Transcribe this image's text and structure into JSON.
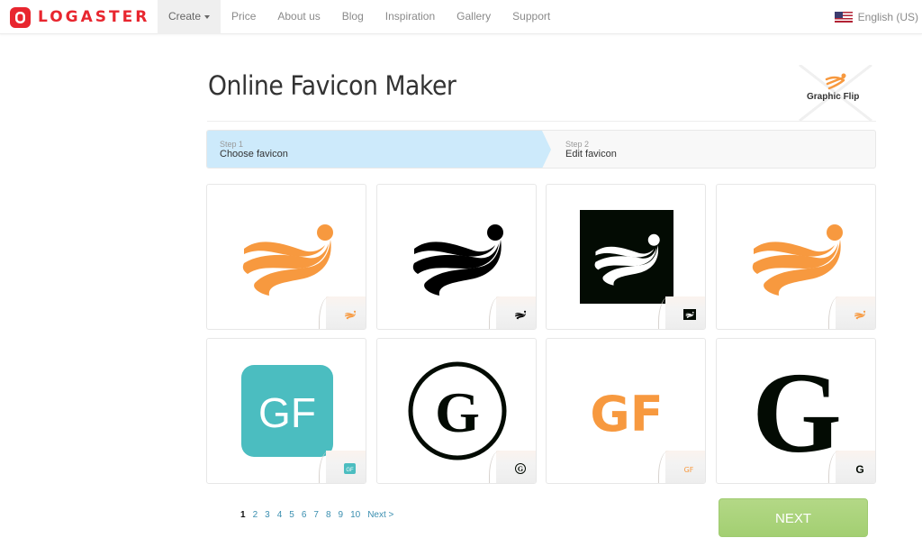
{
  "brand": {
    "name": "LOGASTER",
    "color": "#e8262f"
  },
  "nav": {
    "items": [
      {
        "label": "Create",
        "active": true,
        "dropdown": true
      },
      {
        "label": "Price"
      },
      {
        "label": "About us"
      },
      {
        "label": "Blog"
      },
      {
        "label": "Inspiration"
      },
      {
        "label": "Gallery"
      },
      {
        "label": "Support"
      }
    ],
    "language": {
      "label": "English (US)",
      "icon": "us-flag-icon"
    }
  },
  "page": {
    "title": "Online Favicon Maker",
    "partner_logo_text": "Graphic Flip"
  },
  "steps": [
    {
      "number_label": "Step 1",
      "label": "Choose favicon",
      "active": true,
      "color": "#cdeafb"
    },
    {
      "number_label": "Step 2",
      "label": "Edit favicon",
      "active": false
    }
  ],
  "favicons": [
    {
      "id": 1,
      "style": "swoosh",
      "fg": "#f7993f",
      "bg": "none"
    },
    {
      "id": 2,
      "style": "swoosh",
      "fg": "#000000",
      "bg": "none"
    },
    {
      "id": 3,
      "style": "swoosh",
      "fg": "#ffffff",
      "bg": "#030b03"
    },
    {
      "id": 4,
      "style": "swoosh",
      "fg": "#f7993f",
      "bg": "none"
    },
    {
      "id": 5,
      "style": "text",
      "text": "GF",
      "fg": "#ffffff",
      "bg": "#4bbdc0"
    },
    {
      "id": 6,
      "style": "circle-letter",
      "text": "G",
      "fg": "#030b03",
      "bg": "none"
    },
    {
      "id": 7,
      "style": "text",
      "text": "GF",
      "fg": "#f7993f",
      "bg": "none"
    },
    {
      "id": 8,
      "style": "serif-letter",
      "text": "G",
      "fg": "#030b03",
      "bg": "none"
    }
  ],
  "pagination": {
    "current": "1",
    "pages": [
      "1",
      "2",
      "3",
      "4",
      "5",
      "6",
      "7",
      "8",
      "9",
      "10"
    ],
    "next_label": "Next >"
  },
  "next_button": {
    "label": "NEXT",
    "color": "#a9d37a"
  }
}
